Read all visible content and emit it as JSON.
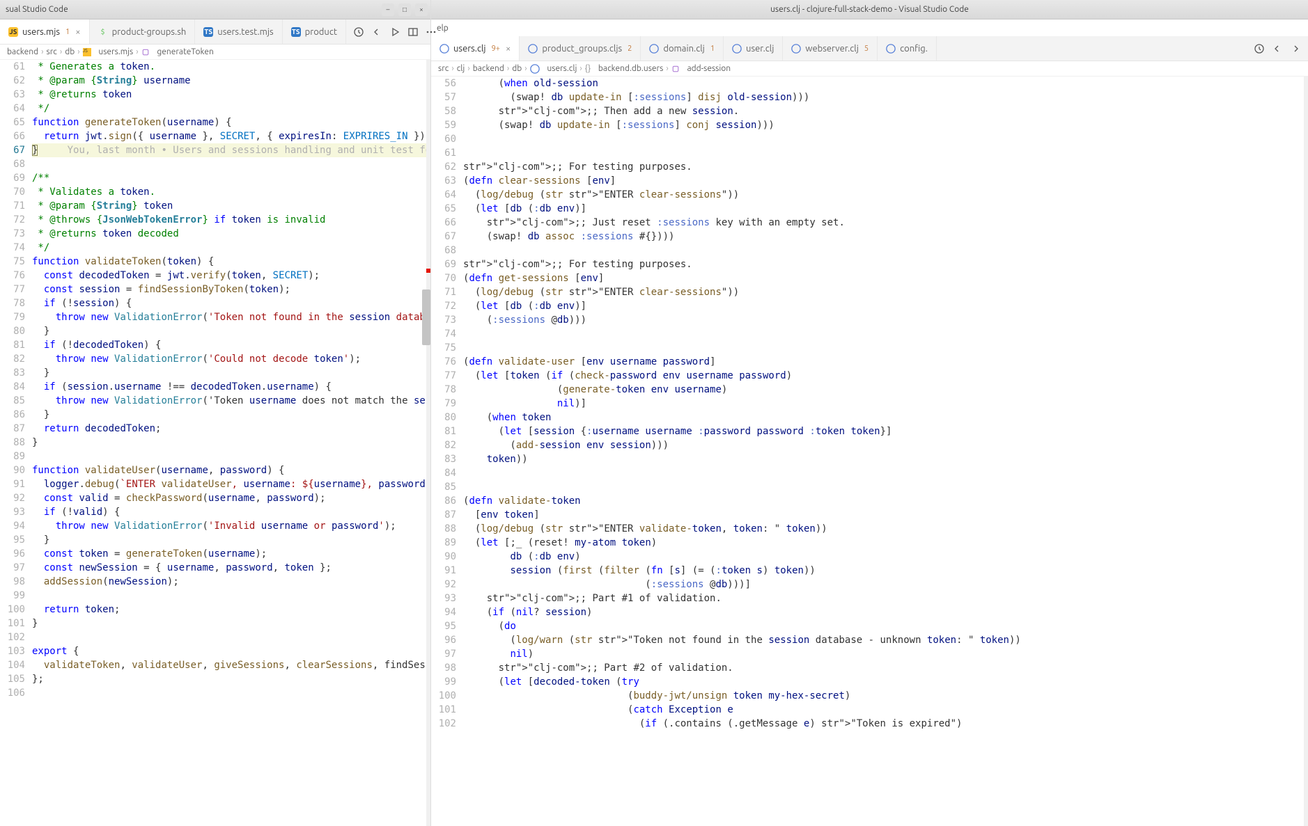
{
  "left": {
    "window_title": "sual Studio Code",
    "tabs": [
      {
        "icon": "js",
        "label": "users.mjs",
        "dirty": "1",
        "active": true,
        "close": true
      },
      {
        "icon": "sh",
        "label": "product-groups.sh"
      },
      {
        "icon": "ts",
        "label": "users.test.mjs"
      },
      {
        "icon": "ts",
        "label": "product"
      }
    ],
    "breadcrumbs": [
      "backend",
      "src",
      "db",
      "users.mjs",
      "generateToken"
    ],
    "line_start": 61,
    "git_annotation": "You, last month • Users and sessions handling and unit test for the…",
    "code": [
      " * Generates a token.",
      " * @param {String} username",
      " * @returns token",
      " */",
      "function generateToken(username) {",
      "  return jwt.sign({ username }, SECRET, { expiresIn: EXPRIRES_IN });",
      "}",
      "",
      "/**",
      " * Validates a token.",
      " * @param {String} token",
      " * @throws {JsonWebTokenError} if token is invalid",
      " * @returns token decoded",
      " */",
      "function validateToken(token) {",
      "  const decodedToken = jwt.verify(token, SECRET);",
      "  const session = findSessionByToken(token);",
      "  if (!session) {",
      "    throw new ValidationError('Token not found in the session database');",
      "  }",
      "  if (!decodedToken) {",
      "    throw new ValidationError('Could not decode token');",
      "  }",
      "  if (session.username !== decodedToken.username) {",
      "    throw new ValidationError('Token username does not match the session use",
      "  }",
      "  return decodedToken;",
      "}",
      "",
      "function validateUser(username, password) {",
      "  logger.debug(`ENTER validateUser, username: ${username}, password: ${passw",
      "  const valid = checkPassword(username, password);",
      "  if (!valid) {",
      "    throw new ValidationError('Invalid username or password');",
      "  }",
      "  const token = generateToken(username);",
      "  const newSession = { username, password, token };",
      "  addSession(newSession);",
      "",
      "  return token;",
      "}",
      "",
      "export {",
      "  validateToken, validateUser, giveSessions, clearSessions, findSessionByTok",
      "};",
      ""
    ]
  },
  "right": {
    "window_title": "users.clj - clojure-full-stack-demo - Visual Studio Code",
    "menu_item": "elp",
    "tabs": [
      {
        "icon": "clj",
        "label": "users.clj",
        "dirty": "9+",
        "active": true,
        "close": true
      },
      {
        "icon": "clj",
        "label": "product_groups.cljs",
        "dirty": "2"
      },
      {
        "icon": "clj",
        "label": "domain.clj",
        "dirty": "1"
      },
      {
        "icon": "clj",
        "label": "user.clj"
      },
      {
        "icon": "clj",
        "label": "webserver.clj",
        "dirty": "5"
      },
      {
        "icon": "clj",
        "label": "config."
      }
    ],
    "breadcrumbs": [
      "src",
      "clj",
      "backend",
      "db",
      "users.clj",
      "backend.db.users",
      "add-session"
    ],
    "line_numbers": [
      56,
      57,
      58,
      59,
      60,
      61,
      62,
      63,
      64,
      65,
      66,
      67,
      68,
      69,
      70,
      71,
      72,
      73,
      74,
      75,
      76,
      77,
      78,
      79,
      80,
      81,
      82,
      83,
      84,
      85,
      86,
      87,
      88,
      89,
      90,
      91,
      92,
      93,
      94,
      95,
      96,
      97,
      98,
      99,
      100,
      101,
      102
    ],
    "code": [
      "      (when old-session",
      "        (swap! db update-in [:sessions] disj old-session)))",
      "      ;; Then add a new session.",
      "      (swap! db update-in [:sessions] conj session)))",
      "",
      "",
      ";; For testing purposes.",
      "(defn clear-sessions [env]",
      "  (log/debug (str \"ENTER clear-sessions\"))",
      "  (let [db (:db env)]",
      "    ;; Just reset :sessions key with an empty set.",
      "    (swap! db assoc :sessions #{})))",
      "",
      ";; For testing purposes.",
      "(defn get-sessions [env]",
      "  (log/debug (str \"ENTER clear-sessions\"))",
      "  (let [db (:db env)]",
      "    (:sessions @db)))",
      "",
      "",
      "(defn validate-user [env username password]",
      "  (let [token (if (check-password env username password)",
      "                (generate-token env username)",
      "                nil)]",
      "    (when token",
      "      (let [session {:username username :password password :token token}]",
      "        (add-session env session)))",
      "    token))",
      "",
      "",
      "(defn validate-token",
      "  [env token]",
      "  (log/debug (str \"ENTER validate-token, token: \" token))",
      "  (let [;_ (reset! my-atom token)",
      "        db (:db env)",
      "        session (first (filter (fn [s] (= (:token s) token))",
      "                               (:sessions @db)))]",
      "    ;; Part #1 of validation.",
      "    (if (nil? session)",
      "      (do",
      "        (log/warn (str \"Token not found in the session database - unknown token: \" token))",
      "        nil)",
      "      ;; Part #2 of validation.",
      "      (let [decoded-token (try",
      "                            (buddy-jwt/unsign token my-hex-secret)",
      "                            (catch Exception e",
      "                              (if (.contains (.getMessage e) \"Token is expired\")"
    ]
  },
  "icons": {
    "close": "×"
  }
}
